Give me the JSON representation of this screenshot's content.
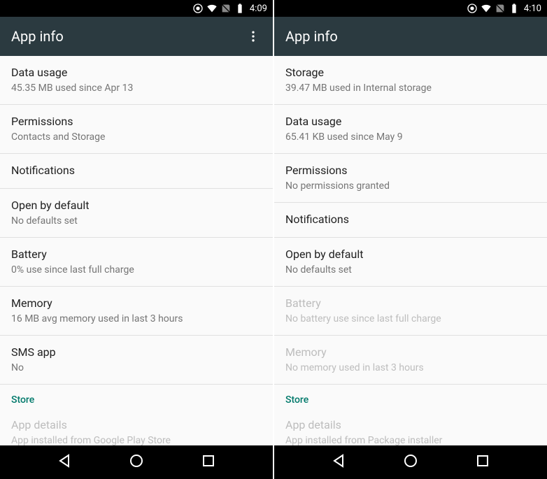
{
  "screens": [
    {
      "status": {
        "time": "4:09"
      },
      "appBar": {
        "title": "App info",
        "hasOverflow": true
      },
      "items": [
        {
          "title": "Data usage",
          "subtitle": "45.35 MB used since Apr 13",
          "disabled": false
        },
        {
          "title": "Permissions",
          "subtitle": "Contacts and Storage",
          "disabled": false
        },
        {
          "title": "Notifications",
          "subtitle": "",
          "disabled": false
        },
        {
          "title": "Open by default",
          "subtitle": "No defaults set",
          "disabled": false
        },
        {
          "title": "Battery",
          "subtitle": "0% use since last full charge",
          "disabled": false
        },
        {
          "title": "Memory",
          "subtitle": "16 MB avg memory used in last 3 hours",
          "disabled": false
        },
        {
          "title": "SMS app",
          "subtitle": "No",
          "disabled": false
        }
      ],
      "sectionHeader": "Store",
      "footerItem": {
        "title": "App details",
        "subtitle": "App installed from Google Play Store",
        "disabled": true
      }
    },
    {
      "status": {
        "time": "4:10"
      },
      "appBar": {
        "title": "App info",
        "hasOverflow": false
      },
      "items": [
        {
          "title": "Storage",
          "subtitle": "39.47 MB used in Internal storage",
          "disabled": false
        },
        {
          "title": "Data usage",
          "subtitle": "65.41 KB used since May 9",
          "disabled": false
        },
        {
          "title": "Permissions",
          "subtitle": "No permissions granted",
          "disabled": false
        },
        {
          "title": "Notifications",
          "subtitle": "",
          "disabled": false
        },
        {
          "title": "Open by default",
          "subtitle": "No defaults set",
          "disabled": false
        },
        {
          "title": "Battery",
          "subtitle": "No battery use since last full charge",
          "disabled": true
        },
        {
          "title": "Memory",
          "subtitle": "No memory used in last 3 hours",
          "disabled": true
        }
      ],
      "sectionHeader": "Store",
      "footerItem": {
        "title": "App details",
        "subtitle": "App installed from Package installer",
        "disabled": true
      }
    }
  ]
}
